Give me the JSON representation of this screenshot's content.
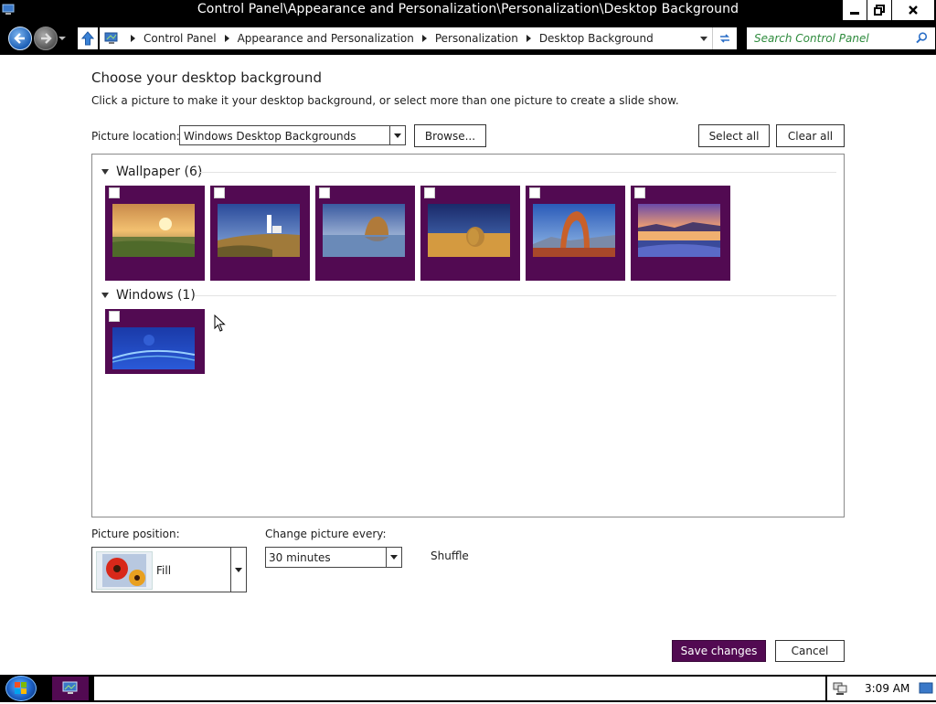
{
  "window": {
    "title": "Control Panel\\Appearance and Personalization\\Personalization\\Desktop Background",
    "minimize_icon": "minimize-icon",
    "maximize_icon": "restore-icon",
    "close_icon": "close-icon"
  },
  "address": {
    "breadcrumbs": [
      "Control Panel",
      "Appearance and Personalization",
      "Personalization",
      "Desktop Background"
    ],
    "search_placeholder": "Search Control Panel"
  },
  "content": {
    "heading": "Choose your desktop background",
    "subtitle": "Click a picture to make it your desktop background, or select more than one picture to create a slide show.",
    "picture_location_label": "Picture location:",
    "picture_location_value": "Windows Desktop Backgrounds",
    "browse_label": "Browse...",
    "select_all_label": "Select all",
    "clear_all_label": "Clear all"
  },
  "groups": [
    {
      "label": "Wallpaper (6)",
      "items": [
        {
          "name": "sunset-meadow",
          "checked": false
        },
        {
          "name": "lighthouse-coast",
          "checked": false
        },
        {
          "name": "haystack-rock",
          "checked": false
        },
        {
          "name": "hay-bale-field",
          "checked": false
        },
        {
          "name": "delicate-arch",
          "checked": false
        },
        {
          "name": "lupine-lake",
          "checked": false
        }
      ]
    },
    {
      "label": "Windows (1)",
      "items": [
        {
          "name": "windows-default",
          "checked": false
        }
      ]
    }
  ],
  "bottom": {
    "picture_position_label": "Picture position:",
    "picture_position_value": "Fill",
    "change_label": "Change picture every:",
    "change_value": "30 minutes",
    "shuffle_label": "Shuffle",
    "save_label": "Save changes",
    "cancel_label": "Cancel"
  },
  "taskbar": {
    "time": "3:09 AM"
  },
  "colors": {
    "accent": "#520a52",
    "chrome": "#000000",
    "search_text": "#2e8b3d"
  }
}
